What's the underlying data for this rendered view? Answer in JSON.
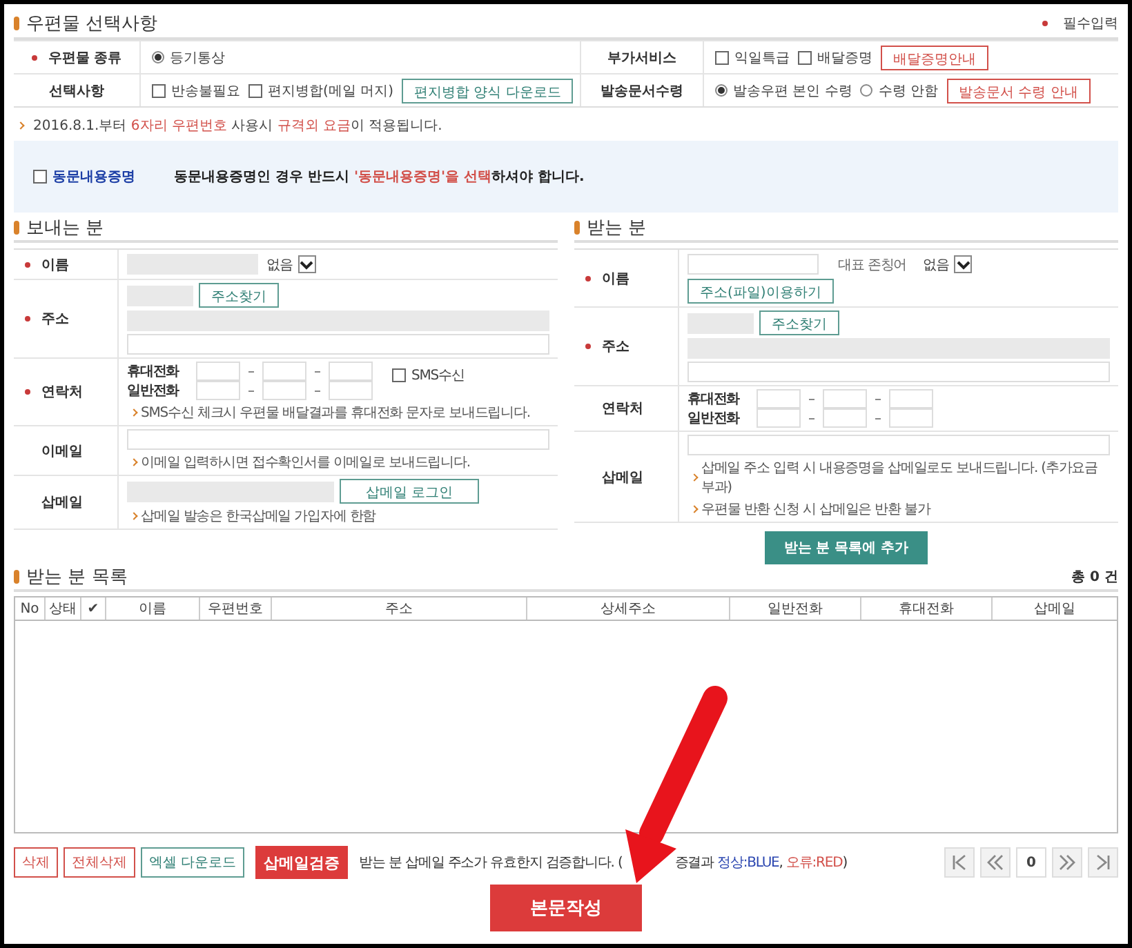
{
  "options": {
    "title": "우편물 선택사항",
    "required_note": "필수입력",
    "rows": [
      {
        "cells": [
          {
            "label": "우편물 종류",
            "required": true,
            "controls": [
              {
                "kind": "radio",
                "label": "등기통상",
                "selected": true
              }
            ]
          },
          {
            "label": "부가서비스",
            "required": false,
            "controls": [
              {
                "kind": "checkbox",
                "label": "익일특급",
                "checked": false
              },
              {
                "kind": "checkbox",
                "label": "배달증명",
                "checked": false
              },
              {
                "kind": "red_button",
                "label": "배달증명안내"
              }
            ]
          }
        ]
      },
      {
        "cells": [
          {
            "label": "선택사항",
            "required": false,
            "controls": [
              {
                "kind": "checkbox",
                "label": "반송불필요",
                "checked": false
              },
              {
                "kind": "checkbox",
                "label": "편지병합(메일 머지)",
                "checked": false
              },
              {
                "kind": "teal_button",
                "label": "편지병합 양식 다운로드"
              }
            ]
          },
          {
            "label": "발송문서수령",
            "required": false,
            "controls": [
              {
                "kind": "radio",
                "label": "발송우편 본인 수령",
                "selected": true
              },
              {
                "kind": "radio",
                "label": "수령 안함",
                "selected": false
              },
              {
                "kind": "red_button",
                "label": "발송문서 수령 안내"
              }
            ]
          }
        ]
      }
    ]
  },
  "notice": [
    {
      "kind": "plain",
      "text": "2016.8.1.부터 "
    },
    {
      "kind": "highlight",
      "text": "6자리 우편번호"
    },
    {
      "kind": "plain",
      "text": " 사용시 "
    },
    {
      "kind": "highlight",
      "text": "규격외 요금"
    },
    {
      "kind": "plain",
      "text": "이 적용됩니다."
    }
  ],
  "same_content": {
    "label": "동문내용증명",
    "checked": false,
    "message": [
      {
        "kind": "plain",
        "text": "동문내용증명인 경우 반드시 "
      },
      {
        "kind": "highlight",
        "text": "'동문내용증명'을 선택"
      },
      {
        "kind": "plain",
        "text": "하셔야 합니다."
      }
    ]
  },
  "sender": {
    "title": "보내는 분",
    "rows": [
      {
        "kind": "name",
        "label": "이름",
        "required": true,
        "disabled": true,
        "select": "없음"
      },
      {
        "kind": "address",
        "label": "주소",
        "required": true,
        "button": "주소찾기"
      },
      {
        "kind": "phone",
        "label": "연락처",
        "required": true,
        "phones": [
          "휴대전화",
          "일반전화"
        ],
        "sms": {
          "label": "SMS수신",
          "checked": false
        },
        "hints": [
          "SMS수신 체크시 우편물 배달결과를 휴대전화 문자로 보내드립니다."
        ]
      },
      {
        "kind": "text",
        "label": "이메일",
        "required": false,
        "disabled": false,
        "hints": [
          "이메일 입력하시면 접수확인서를 이메일로 보내드립니다."
        ]
      },
      {
        "kind": "text",
        "label": "삽메일",
        "required": false,
        "disabled": true,
        "button": "삽메일 로그인",
        "hints": [
          "삽메일 발송은 한국삽메일 가입자에 한함"
        ]
      }
    ]
  },
  "receiver": {
    "title": "받는 분",
    "rows": [
      {
        "kind": "name",
        "label": "이름",
        "required": true,
        "disabled": false,
        "honorific_label": "대표 존칭어",
        "select": "없음",
        "button": "주소(파일)이용하기"
      },
      {
        "kind": "address",
        "label": "주소",
        "required": true,
        "button": "주소찾기"
      },
      {
        "kind": "phone",
        "label": "연락처",
        "required": false,
        "phones": [
          "휴대전화",
          "일반전화"
        ]
      },
      {
        "kind": "text",
        "label": "삽메일",
        "required": false,
        "disabled": false,
        "hints": [
          "삽메일 주소 입력 시 내용증명을 삽메일로도 보내드립니다. (추가요금부과)",
          "우편물 반환 신청 시 삽메일은 반환 불가"
        ]
      }
    ],
    "add_button": "받는 분 목록에 추가"
  },
  "list": {
    "title": "받는 분 목록",
    "total": "총 0 건",
    "columns": [
      "No",
      "상태",
      "✔",
      "이름",
      "우편번호",
      "주소",
      "상세주소",
      "일반전화",
      "휴대전화",
      "삽메일"
    ]
  },
  "actions": [
    {
      "kind": "red_button",
      "label": "삭제"
    },
    {
      "kind": "red_button",
      "label": "전체삭제"
    },
    {
      "kind": "teal_button",
      "label": "엑셀 다운로드"
    }
  ],
  "verify": {
    "button": "삽메일검증",
    "note": [
      {
        "kind": "plain",
        "text": "받는 분 삽메일 주소가 유효한지 검증합니다. ("
      },
      {
        "kind": "after_cover",
        "text": "증결과 "
      },
      {
        "kind": "blue",
        "text": "정상:BLUE"
      },
      {
        "kind": "plain",
        "text": ", "
      },
      {
        "kind": "highlight",
        "text": "오류:RED"
      },
      {
        "kind": "plain",
        "text": ")"
      }
    ]
  },
  "pagination": {
    "page": "0"
  },
  "submit": "본문작성"
}
